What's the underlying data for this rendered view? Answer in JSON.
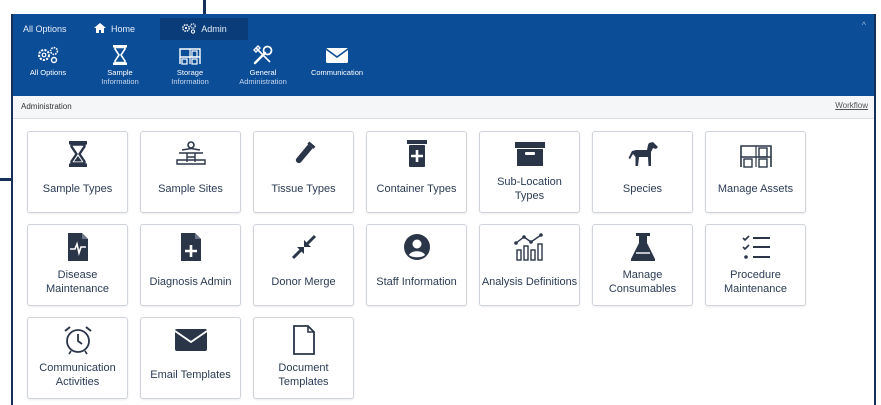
{
  "ribbon": {
    "tabs": [
      {
        "label": "All Options",
        "icon": "none"
      },
      {
        "label": "Home",
        "icon": "home-icon"
      },
      {
        "label": "Admin",
        "icon": "gears-icon"
      }
    ],
    "collapse_glyph": "^",
    "buttons": [
      {
        "label": "All Options",
        "sub": "",
        "icon": "gears-icon"
      },
      {
        "label": "Sample",
        "sub": "Information",
        "icon": "hourglass-icon"
      },
      {
        "label": "Storage",
        "sub": "Information",
        "icon": "shelves-icon"
      },
      {
        "label": "General",
        "sub": "Administration",
        "icon": "tools-icon"
      },
      {
        "label": "Communication",
        "sub": "",
        "icon": "envelope-icon"
      }
    ]
  },
  "breadcrumb": "Administration",
  "workflow_label": "Workflow",
  "tiles": [
    {
      "label": "Sample Types",
      "icon": "hourglass-icon"
    },
    {
      "label": "Sample Sites",
      "icon": "body-site-icon"
    },
    {
      "label": "Tissue Types",
      "icon": "test-tube-icon"
    },
    {
      "label": "Container Types",
      "icon": "medical-container-icon"
    },
    {
      "label": "Sub-Location Types",
      "icon": "archive-box-icon"
    },
    {
      "label": "Species",
      "icon": "horse-icon"
    },
    {
      "label": "Manage Assets",
      "icon": "shelves-icon"
    },
    {
      "label": "Disease Maintenance",
      "icon": "medical-file-icon"
    },
    {
      "label": "Diagnosis Admin",
      "icon": "file-plus-icon"
    },
    {
      "label": "Donor Merge",
      "icon": "compress-arrows-icon"
    },
    {
      "label": "Staff Information",
      "icon": "user-circle-icon"
    },
    {
      "label": "Analysis Definitions",
      "icon": "analytics-icon"
    },
    {
      "label": "Manage Consumables",
      "icon": "flask-icon"
    },
    {
      "label": "Procedure Maintenance",
      "icon": "checklist-icon"
    },
    {
      "label": "Communication Activities",
      "icon": "alarm-clock-icon"
    },
    {
      "label": "Email Templates",
      "icon": "envelope-icon"
    },
    {
      "label": "Document Templates",
      "icon": "document-icon"
    }
  ],
  "colors": {
    "ribbon_bg": "#0b4d97",
    "active_tab_bg": "#093c78",
    "icon_dark": "#2a3548",
    "border": "#16305a"
  }
}
